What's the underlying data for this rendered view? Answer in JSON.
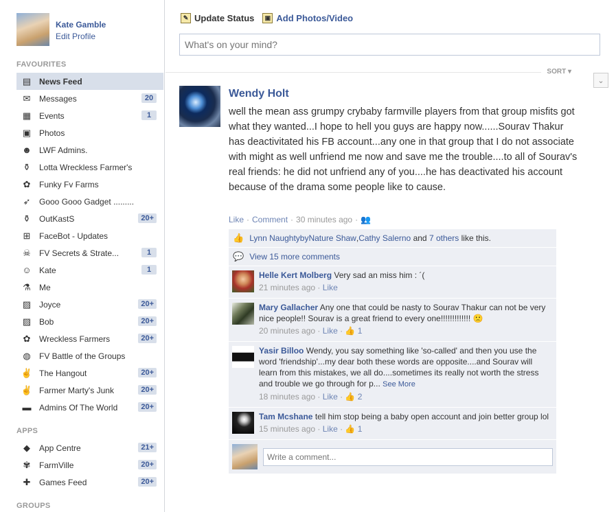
{
  "profile": {
    "name": "Kate Gamble",
    "edit_label": "Edit Profile"
  },
  "sections": {
    "favourites": "FAVOURITES",
    "apps": "APPS",
    "groups": "GROUPS"
  },
  "favourites": [
    {
      "label": "News Feed",
      "icon": "news-feed-icon",
      "glyph": "▤",
      "badge": "",
      "active": true
    },
    {
      "label": "Messages",
      "icon": "messages-icon",
      "glyph": "✉",
      "badge": "20"
    },
    {
      "label": "Events",
      "icon": "events-icon",
      "glyph": "▦",
      "badge": "1"
    },
    {
      "label": "Photos",
      "icon": "photos-icon",
      "glyph": "▣",
      "badge": ""
    },
    {
      "label": "LWF Admins.",
      "icon": "group-icon",
      "glyph": "☻",
      "badge": ""
    },
    {
      "label": "Lotta Wreckless Farmer's",
      "icon": "wine-icon",
      "glyph": "⚱",
      "badge": ""
    },
    {
      "label": "Funky Fv Farms",
      "icon": "flower-icon",
      "glyph": "✿",
      "badge": ""
    },
    {
      "label": "Gooo Gooo Gadget .........",
      "icon": "shoe-icon",
      "glyph": "➶",
      "badge": ""
    },
    {
      "label": "OutKastS",
      "icon": "wine-icon",
      "glyph": "⚱",
      "badge": "20+"
    },
    {
      "label": "FaceBot - Updates",
      "icon": "sitemap-icon",
      "glyph": "⊞",
      "badge": ""
    },
    {
      "label": "FV Secrets & Strate...",
      "icon": "skull-icon",
      "glyph": "☠",
      "badge": "1"
    },
    {
      "label": "Kate",
      "icon": "people-icon",
      "glyph": "☺",
      "badge": "1"
    },
    {
      "label": "Me",
      "icon": "flask-icon",
      "glyph": "⚗",
      "badge": ""
    },
    {
      "label": "Joyce",
      "icon": "document-icon",
      "glyph": "▨",
      "badge": "20+"
    },
    {
      "label": "Bob",
      "icon": "document-icon",
      "glyph": "▨",
      "badge": "20+"
    },
    {
      "label": "Wreckless Farmers",
      "icon": "flower-icon",
      "glyph": "✿",
      "badge": "20+"
    },
    {
      "label": "FV Battle of the Groups",
      "icon": "globe-icon",
      "glyph": "◍",
      "badge": ""
    },
    {
      "label": "The Hangout",
      "icon": "rock-hand-icon",
      "glyph": "✌",
      "badge": "20+"
    },
    {
      "label": "Farmer Marty's Junk",
      "icon": "rock-hand-icon",
      "glyph": "✌",
      "badge": "20+"
    },
    {
      "label": "Admins Of The World",
      "icon": "rainbow-flag-icon",
      "glyph": "▬",
      "badge": "20+"
    }
  ],
  "apps": [
    {
      "label": "App Centre",
      "icon": "app-centre-icon",
      "glyph": "◆",
      "badge": "21+"
    },
    {
      "label": "FarmVille",
      "icon": "farmville-icon",
      "glyph": "✾",
      "badge": "20+"
    },
    {
      "label": "Games Feed",
      "icon": "puzzle-icon",
      "glyph": "✚",
      "badge": "20+"
    }
  ],
  "composer": {
    "update_status": "Update Status",
    "add_photos": "Add Photos/Video",
    "placeholder": "What's on your mind?"
  },
  "sort_label": "SORT ▾",
  "post": {
    "author": "Wendy Holt",
    "text": "well the mean ass grumpy crybaby farmville players from that group misfits got what they wanted...I hope to hell you guys are happy now......Sourav Thakur has deactivitated his FB account...any one in that group that I do not associate with might as well unfriend me now and save me the trouble....to all of Sourav's real friends: he did not unfriend any of you....he has deactivated his account because of the drama some people like to cause.",
    "like_label": "Like",
    "comment_label": "Comment",
    "time": "30 minutes ago",
    "likes": {
      "name1": "Lynn NaughtybyNature Shaw",
      "sep": ", ",
      "name2": "Cathy Salerno",
      "and": " and ",
      "others": "7 others",
      "suffix": " like this."
    },
    "view_more": "View 15 more comments",
    "comments": [
      {
        "author": "Helle Kert Molberg",
        "text": "Very sad an miss him : ´(",
        "time": "21 minutes ago",
        "like": "Like",
        "likes": "",
        "see_more": ""
      },
      {
        "author": "Mary Gallacher",
        "text": "Any one that could be nasty to Sourav Thakur can not be very nice people!! Sourav is a great friend to every one!!!!!!!!!!!!! 🙁",
        "time": "20 minutes ago",
        "like": "Like",
        "likes": "1",
        "see_more": ""
      },
      {
        "author": "Yasir Billoo",
        "text": "Wendy, you say something like 'so-called' and then you use the word 'friendship'...my dear both these words are opposite....and Sourav will learn from this mistakes, we all do....sometimes its really not worth the stress and trouble we go through for p...",
        "time": "18 minutes ago",
        "like": "Like",
        "likes": "2",
        "see_more": "See More"
      },
      {
        "author": "Tam Mcshane",
        "text": "tell him stop being a baby open account and join better group lol",
        "time": "15 minutes ago",
        "like": "Like",
        "likes": "1",
        "see_more": ""
      }
    ],
    "write_placeholder": "Write a comment..."
  },
  "colors": {
    "brand": "#3b5998",
    "badge_bg": "#d8dfea",
    "ufi_bg": "#edeff4"
  }
}
